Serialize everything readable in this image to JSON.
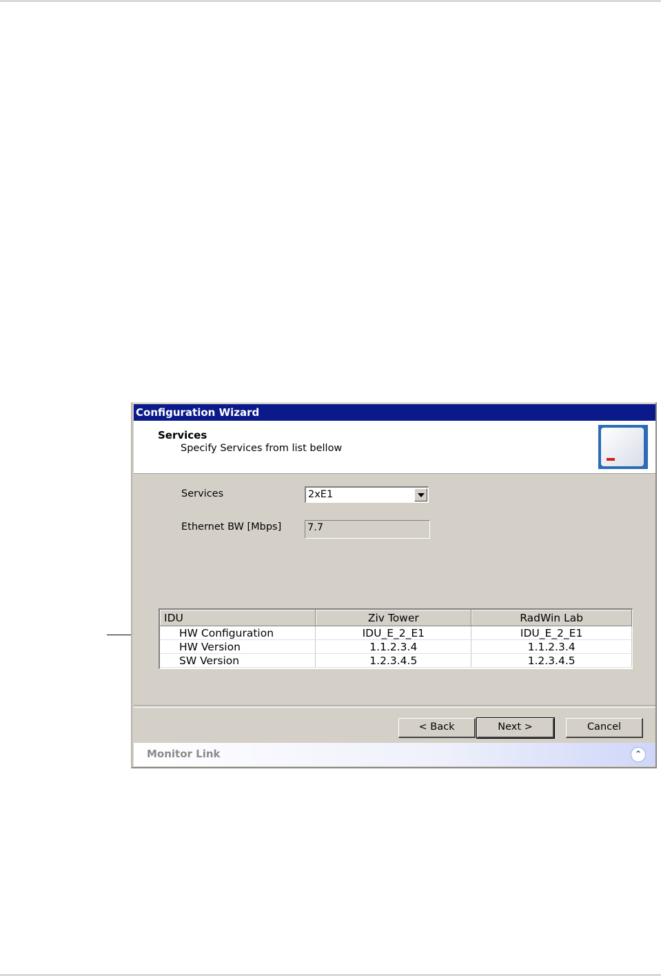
{
  "window": {
    "title": "Configuration Wizard"
  },
  "header": {
    "title": "Services",
    "subtitle": "Specify Services from list bellow",
    "logo_icon": "radio-antenna-icon"
  },
  "form": {
    "services_label": "Services",
    "services_value": "2xE1",
    "ethernet_bw_label": "Ethernet BW [Mbps]",
    "ethernet_bw_value": "7.7"
  },
  "table": {
    "headers": [
      "IDU",
      "Ziv Tower",
      "RadWin Lab"
    ],
    "rows": [
      [
        "HW Configuration",
        "IDU_E_2_E1",
        "IDU_E_2_E1"
      ],
      [
        "HW Version",
        "1.1.2.3.4",
        "1.1.2.3.4"
      ],
      [
        "SW Version",
        "1.2.3.4.5",
        "1.2.3.4.5"
      ]
    ]
  },
  "buttons": {
    "back": "< Back",
    "next": "Next >",
    "cancel": "Cancel"
  },
  "footer": {
    "text": "Monitor Link",
    "expand_icon": "double-chevron-up-icon"
  },
  "colors": {
    "titlebar": "#0a1a8a",
    "dialog_bg": "#d4d0c8"
  }
}
